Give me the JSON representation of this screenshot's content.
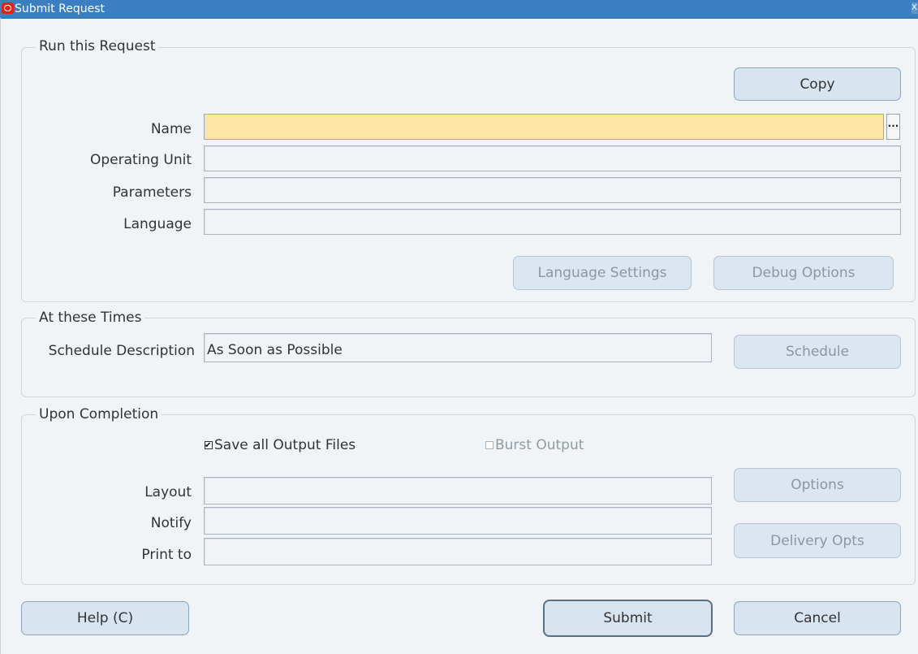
{
  "window": {
    "title": "Submit Request",
    "close_glyph": "X"
  },
  "run_request": {
    "legend": "Run this Request",
    "copy_button": "Copy",
    "name_label": "Name",
    "name_value": "",
    "lov_glyph": "...",
    "operating_unit_label": "Operating Unit",
    "operating_unit_value": "",
    "parameters_label": "Parameters",
    "parameters_value": "",
    "language_label": "Language",
    "language_value": "",
    "language_settings_button": "Language Settings",
    "debug_options_button": "Debug Options"
  },
  "at_these_times": {
    "legend": "At these Times",
    "schedule_description_label": "Schedule Description",
    "schedule_description_value": "As Soon as Possible",
    "schedule_button": "Schedule"
  },
  "upon_completion": {
    "legend": "Upon Completion",
    "save_output_label": "Save all Output Files",
    "save_output_checked": true,
    "burst_output_label": "Burst Output",
    "burst_output_checked": false,
    "layout_label": "Layout",
    "layout_value": "",
    "notify_label": "Notify",
    "notify_value": "",
    "print_to_label": "Print to",
    "print_to_value": "",
    "options_button": "Options",
    "delivery_opts_button": "Delivery Opts"
  },
  "footer": {
    "help_button": "Help (C)",
    "submit_button": "Submit",
    "cancel_button": "Cancel"
  },
  "colors": {
    "title_bar": "#3a7fc2",
    "required_field": "#fde5a5",
    "button_fill": "#d8e4f0",
    "background": "#f1f4f7"
  }
}
